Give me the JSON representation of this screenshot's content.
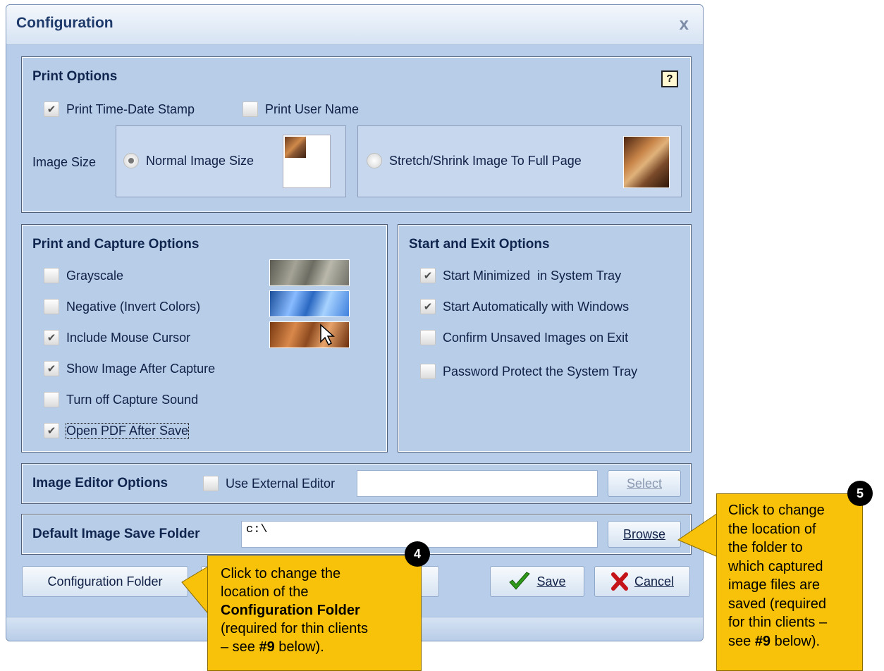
{
  "dialog": {
    "title": "Configuration",
    "close_glyph": "x"
  },
  "print_options": {
    "title": "Print Options",
    "help_glyph": "?",
    "print_time_date_stamp": {
      "label": "Print Time-Date Stamp",
      "checked": true
    },
    "print_user_name": {
      "label": "Print User Name",
      "checked": false
    },
    "image_size_label": "Image Size",
    "normal_image_size": {
      "label": "Normal Image Size",
      "selected": true
    },
    "stretch_shrink": {
      "label": "Stretch/Shrink Image To Full Page",
      "selected": false
    }
  },
  "print_capture_options": {
    "title": "Print and Capture Options",
    "items": [
      {
        "label": "Grayscale",
        "checked": false
      },
      {
        "label": "Negative (Invert Colors)",
        "checked": false
      },
      {
        "label": "Include Mouse Cursor",
        "checked": true
      },
      {
        "label": "Show Image After Capture",
        "checked": true
      },
      {
        "label": "Turn off Capture Sound",
        "checked": false
      },
      {
        "label": "Open PDF After Save",
        "checked": true
      }
    ]
  },
  "start_exit_options": {
    "title": "Start and Exit Options",
    "items": [
      {
        "label": "Start Minimized  in System Tray",
        "checked": true
      },
      {
        "label": "Start Automatically with Windows",
        "checked": true
      },
      {
        "label": "Confirm Unsaved Images on Exit",
        "checked": false
      },
      {
        "label": "Password Protect the System Tray",
        "checked": false
      }
    ]
  },
  "image_editor_options": {
    "title": "Image Editor Options",
    "use_external_editor": {
      "label": "Use External Editor",
      "checked": false
    },
    "editor_path": "",
    "select_label": "Select"
  },
  "default_save_folder": {
    "title": "Default Image Save Folder",
    "path": "c:\\",
    "browse_label": "Browse"
  },
  "buttons": {
    "configuration_folder": "Configuration Folder",
    "save": "Save",
    "cancel": "Cancel"
  },
  "callout_4": {
    "number": "4",
    "line1": "Click to change the",
    "line2": "location of the",
    "bold": "Configuration Folder",
    "line3": "(required for thin clients",
    "line4_pre": "– see ",
    "line4_bold": "#9",
    "line4_post": " below)."
  },
  "callout_5": {
    "number": "5",
    "line1": "Click to change",
    "line2": "the location of",
    "line3": "the folder to",
    "line4": "which captured",
    "line5": "image files are",
    "line6": "saved (required",
    "line7": "for thin clients –",
    "line8_pre": "see ",
    "line8_bold": "#9",
    "line8_post": " below)."
  },
  "icons": [
    "close-icon",
    "help-icon",
    "checkmark-icon",
    "save-check-icon",
    "cancel-x-icon",
    "mouse-cursor-icon"
  ],
  "colors": {
    "dialog_bg": "#b7cde9",
    "callout": "#f8c20b",
    "title_text": "#1e3a6b"
  }
}
